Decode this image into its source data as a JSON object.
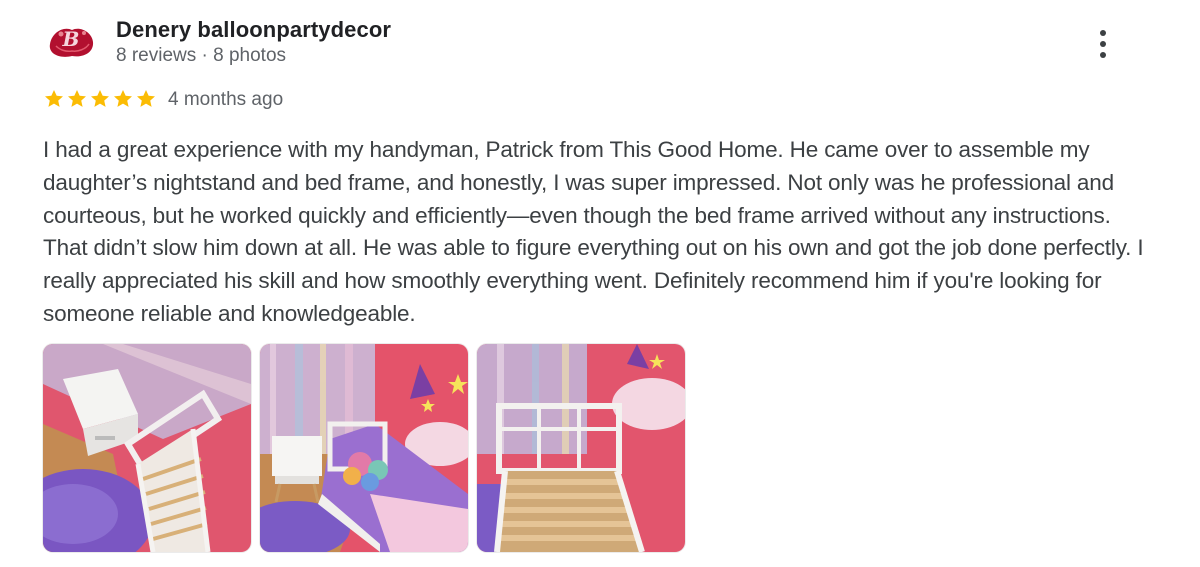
{
  "reviewer": {
    "name": "Denery balloonpartydecor",
    "meta": "8 reviews · 8 photos"
  },
  "rating": {
    "stars": 5,
    "max": 5,
    "time_ago": "4 months ago",
    "star_color": "#fbbc04"
  },
  "review": {
    "text": "I had a great experience with my handyman, Patrick from This Good Home. He came over to assemble my daughter’s nightstand and bed frame, and honestly, I was super impressed. Not only was he professional and courteous, but he worked quickly and efficiently—even though the bed frame arrived without any instructions. That didn’t slow him down at all. He was able to figure everything out on his own and got the job done perfectly. I really appreciated his skill and how smoothly everything went. Definitely recommend him if you're looking for someone reliable and knowledgeable."
  },
  "photos": [
    {
      "alt": "bed-frame-assembly-photo-1"
    },
    {
      "alt": "bed-frame-assembly-photo-2"
    },
    {
      "alt": "bed-frame-assembly-photo-3"
    }
  ],
  "icons": {
    "more": "more-vert-icon",
    "star": "star-icon",
    "avatar": "balloon-logo-avatar"
  },
  "colors": {
    "name": "#202124",
    "secondary": "#5f6368",
    "body": "#3c4043"
  }
}
